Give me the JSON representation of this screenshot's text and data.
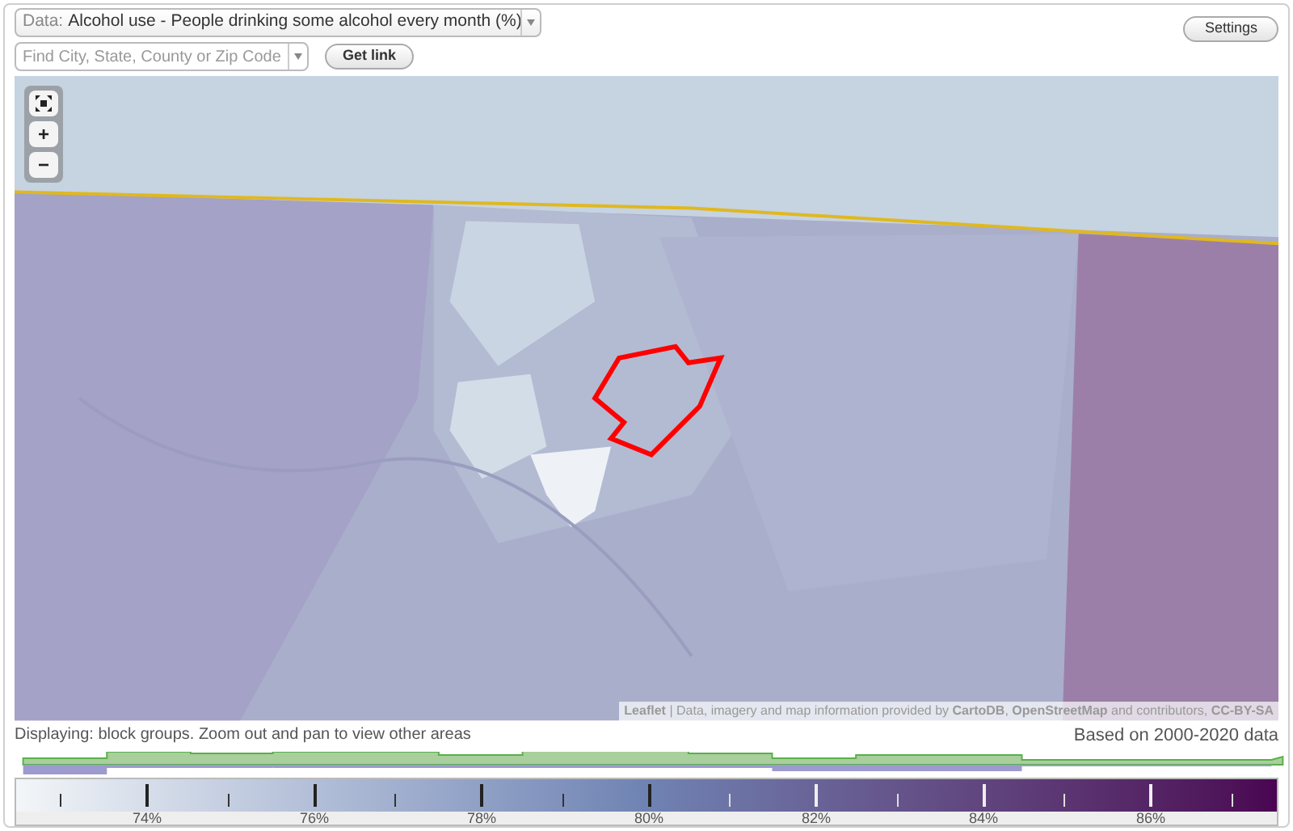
{
  "data_select": {
    "label": "Data:",
    "value": "Alcohol use - People drinking some alcohol every month (%)"
  },
  "search": {
    "placeholder": "Find City, State, County or Zip Code"
  },
  "get_link": "Get link",
  "settings": "Settings",
  "map": {
    "zoom_in": "+",
    "zoom_out": "−",
    "attribution": "**Leaflet** | Data, imagery and map information provided by **CartoDB**, **OpenStreetMap** and contributors, **CC-BY-SA**"
  },
  "status": {
    "displaying": "Displaying: block groups. Zoom out and pan to view other areas",
    "based_on": "Based on 2000-2020 data"
  },
  "legend": {
    "labels": [
      "74%",
      "76%",
      "78%",
      "80%",
      "82%",
      "84%",
      "86%"
    ]
  }
}
